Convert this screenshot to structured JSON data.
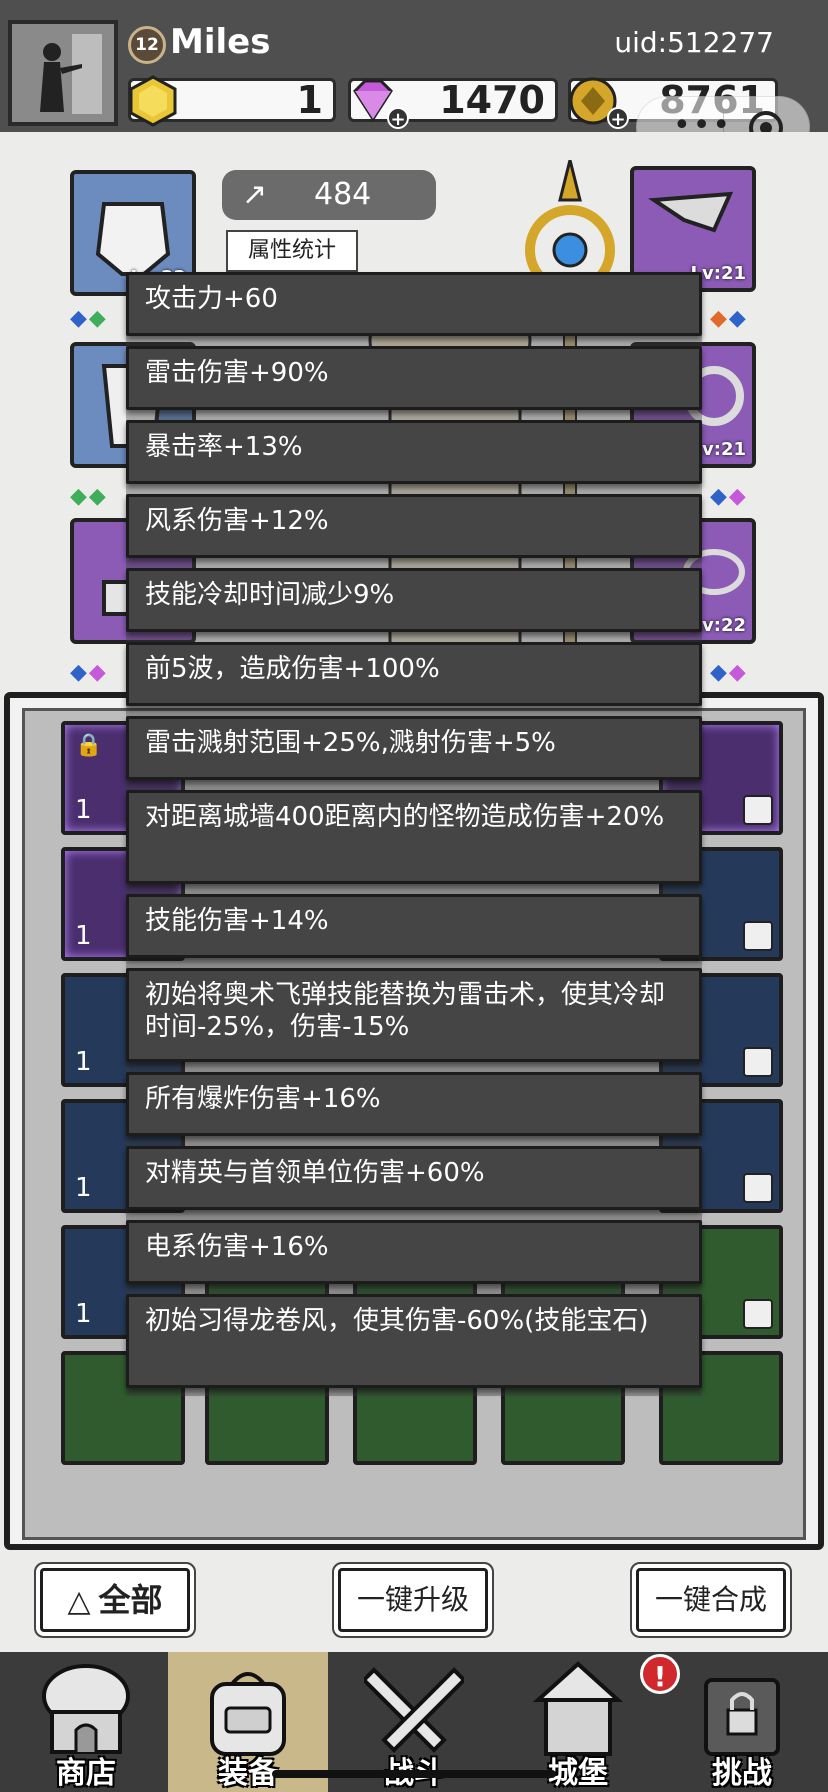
{
  "player": {
    "level": "12",
    "name": "Miles",
    "uid": "uid:512277"
  },
  "currencies": [
    {
      "icon": "hexagon-token-icon",
      "value": "1",
      "color": "#e8c635"
    },
    {
      "icon": "diamond-icon",
      "value": "1470",
      "color": "#c55ad8"
    },
    {
      "icon": "gold-coin-icon",
      "value": "8761",
      "color": "#d4a62a"
    }
  ],
  "equipment": {
    "power_value": "484",
    "stats_button_label": "属性统计",
    "slots": [
      {
        "side": "left",
        "level": "Lv:22",
        "rarity": "blue"
      },
      {
        "side": "right",
        "level": "Lv:21",
        "rarity": "purple"
      },
      {
        "side": "left",
        "level": "",
        "rarity": "blue"
      },
      {
        "side": "right",
        "level": "Lv:21",
        "rarity": "purple"
      },
      {
        "side": "left",
        "level": "",
        "rarity": "purple"
      },
      {
        "side": "right",
        "level": "Lv:22",
        "rarity": "purple"
      }
    ]
  },
  "inventory": {
    "quantity_label": "1"
  },
  "stats_list": [
    "攻击力+60",
    "雷击伤害+90%",
    "暴击率+13%",
    "风系伤害+12%",
    "技能冷却时间减少9%",
    "前5波，造成伤害+100%",
    "雷击溅射范围+25%,溅射伤害+5%",
    "对距离城墙400距离内的怪物造成伤害+20%",
    "技能伤害+14%",
    "初始将奥术飞弹技能替换为雷击术，使其冷却时间-25%，伤害-15%",
    "所有爆炸伤害+16%",
    "对精英与首领单位伤害+60%",
    "电系伤害+16%",
    "初始习得龙卷风，使其伤害-60%(技能宝石)"
  ],
  "actions": {
    "all_label": "全部",
    "upgrade_label": "一键升级",
    "merge_label": "一键合成"
  },
  "nav": {
    "items": [
      {
        "label": "商店",
        "icon": "shop-icon"
      },
      {
        "label": "装备",
        "icon": "backpack-icon"
      },
      {
        "label": "战斗",
        "icon": "crossed-swords-icon"
      },
      {
        "label": "城堡",
        "icon": "castle-icon"
      },
      {
        "label": "挑战",
        "icon": "locked-challenge-icon"
      }
    ],
    "notification": "!"
  }
}
